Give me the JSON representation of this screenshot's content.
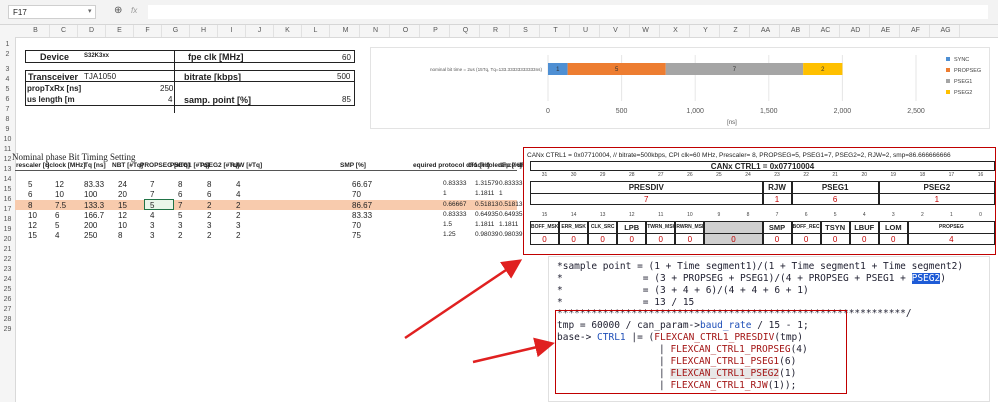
{
  "namebox": "F17",
  "fx": "fx",
  "columns": [
    "B",
    "C",
    "D",
    "E",
    "F",
    "G",
    "H",
    "I",
    "J",
    "K",
    "L",
    "M",
    "N",
    "O",
    "P",
    "Q",
    "R",
    "S",
    "T",
    "U",
    "V",
    "W",
    "X",
    "Y",
    "Z",
    "AA",
    "AB",
    "AC",
    "AD",
    "AE",
    "AF",
    "AG"
  ],
  "rows": [
    "1",
    "2",
    "3",
    "4",
    "5",
    "6",
    "7",
    "8",
    "9",
    "10",
    "11",
    "12",
    "13",
    "14",
    "15",
    "16",
    "17",
    "18",
    "19",
    "20",
    "21",
    "22",
    "23",
    "24",
    "25",
    "26",
    "27",
    "28",
    "29"
  ],
  "params": {
    "device_label": "Device",
    "device_value": "S32K3xx",
    "fpe_label": "fpe clk [MHz]",
    "fpe_value": "60",
    "transceiver_label": "Transceiver",
    "transceiver_value": "TJA1050",
    "bitrate_label": "bitrate [kbps]",
    "bitrate_value": "500",
    "prop_label": "propTxRx [ns]",
    "prop_value": "250",
    "bus_label": "us length [m",
    "bus_value": "4",
    "samp_label": "samp. point [%]",
    "samp_value": "85"
  },
  "chart_data": {
    "type": "bar",
    "orientation": "horizontal",
    "stacked": true,
    "categories": [
      "nominal bit time = 2us (15Tq, Tq=133.33333333333ns)"
    ],
    "series": [
      {
        "name": "SYNC",
        "values": [
          1
        ],
        "label": "1",
        "color": "#4e8fd3"
      },
      {
        "name": "PROPSEG",
        "values": [
          5
        ],
        "label": "5",
        "color": "#ed7d31"
      },
      {
        "name": "PSEG1",
        "values": [
          7
        ],
        "label": "7",
        "color": "#a5a5a5"
      },
      {
        "name": "PSEG2",
        "values": [
          2
        ],
        "label": "2",
        "color": "#ffc000"
      }
    ],
    "xlim": [
      0,
      2500
    ],
    "xticks": [
      "0",
      "500",
      "1,000",
      "1,500",
      "2,000",
      "2,500"
    ],
    "xlabel": "[ns]",
    "legend": "right"
  },
  "table": {
    "title": "Nominal phase Bit Timing Setting",
    "headers": [
      "rescaler [-]",
      "Sclock [MHz]",
      "Tq [ns]",
      "NBT [#Tq]",
      "PROPSEG [#Tq]",
      "PSEG1 [#Tq]",
      "PSEG2 [#Tq]",
      "RJW [#Tq]",
      "SMP [%]",
      "equired protocol dF1 [%]",
      "clock tolerance dF2 [%]",
      "dFp [%]"
    ],
    "rows": [
      [
        "5",
        "12",
        "83.33",
        "24",
        "7",
        "8",
        "8",
        "4",
        "66.67",
        "0.83333",
        "1.31579",
        "0.83333"
      ],
      [
        "6",
        "10",
        "100",
        "20",
        "7",
        "6",
        "6",
        "4",
        "70",
        "1",
        "1.1811",
        "1"
      ],
      [
        "8",
        "7.5",
        "133.3",
        "15",
        "5",
        "7",
        "2",
        "2",
        "86.67",
        "0.66667",
        "0.51813",
        "0.51813"
      ],
      [
        "10",
        "6",
        "166.7",
        "12",
        "4",
        "5",
        "2",
        "2",
        "83.33",
        "0.83333",
        "0.64935",
        "0.64935"
      ],
      [
        "12",
        "5",
        "200",
        "10",
        "3",
        "3",
        "3",
        "3",
        "70",
        "1.5",
        "1.1811",
        "1.1811"
      ],
      [
        "15",
        "4",
        "250",
        "8",
        "3",
        "2",
        "2",
        "2",
        "75",
        "1.25",
        "0.98039",
        "0.98039"
      ]
    ]
  },
  "register": {
    "comment": "CANx CTRL1 = 0x07710004,  // bitrate=500kbps, CPI clk=60 MHz, Prescaler= 8, PROPSEG=5, PSEG1=7, PSEG2=2, RJW=2, smp=86.666666666",
    "title": "CANx CTRL1 = 0x07710004",
    "upper_bits": [
      "31",
      "30",
      "29",
      "28",
      "27",
      "26",
      "25",
      "24",
      "23",
      "22",
      "21",
      "20",
      "19",
      "18",
      "17",
      "16"
    ],
    "upper_fields": [
      {
        "name": "PRESDIV",
        "value": "7"
      },
      {
        "name": "RJW",
        "value": "1"
      },
      {
        "name": "PSEG1",
        "value": "6"
      },
      {
        "name": "PSEG2",
        "value": "1"
      }
    ],
    "lower_bits": [
      "15",
      "14",
      "13",
      "12",
      "11",
      "10",
      "9",
      "8",
      "7",
      "6",
      "5",
      "4",
      "3",
      "2",
      "1",
      "0"
    ],
    "lower_fields": [
      {
        "name": "BOFF_MSK",
        "value": "0"
      },
      {
        "name": "ERR_MSK",
        "value": "0"
      },
      {
        "name": "CLK_SRC",
        "value": "0"
      },
      {
        "name": "LPB",
        "value": "0"
      },
      {
        "name": "TWRN_MSK",
        "value": "0"
      },
      {
        "name": "RWRN_MSK",
        "value": "0"
      },
      {
        "name": "",
        "value": "0"
      },
      {
        "name": "SMP",
        "value": "0"
      },
      {
        "name": "BOFF_REC",
        "value": "0"
      },
      {
        "name": "TSYN",
        "value": "0"
      },
      {
        "name": "LBUF",
        "value": "0"
      },
      {
        "name": "LOM",
        "value": "0"
      },
      {
        "name": "PROPSEG",
        "value": "4"
      }
    ]
  },
  "code": {
    "line1": "*sample point = (1 + Time segment1)/(1 + Time segment1 + Time segment2)",
    "line2a": "*              = (3 + PROPSEG + PSEG1)/(4 + PROPSEG + PSEG1 + ",
    "line2b": "PSEG2",
    "line2c": ")",
    "line3": "*              = (3 + 4 + 6)/(4 + 4 + 6 + 1)",
    "line4": "*              = 13 / 15",
    "line5": "*************************************************************/",
    "line6a": "tmp = 60000 / can_param->",
    "line6b": "baud_rate",
    "line6c": " / 15 - 1;",
    "line7a": "base-> ",
    "line7b": "CTRL1",
    "line7c": " |= (",
    "line7d": "FLEXCAN_CTRL1_PRESDIV",
    "line7e": "(tmp)",
    "line8a": "FLEXCAN_CTRL1_PROPSEG",
    "line8b": "(4)",
    "line9a": "FLEXCAN_CTRL1_PSEG1",
    "line9b": "(6)",
    "line10a": "FLEXCAN_CTRL1_PSEG2",
    "line10b": "(1)",
    "line11a": "FLEXCAN_CTRL1_RJW",
    "line11b": "(1));"
  },
  "colors": {
    "highlight_row": "#f8cbad",
    "selected_cell": "#dff0d8",
    "red_box": "#c00000",
    "arrow": "#e02020",
    "code_keyword": "#1f4fb8",
    "code_macro": "#a31515"
  }
}
